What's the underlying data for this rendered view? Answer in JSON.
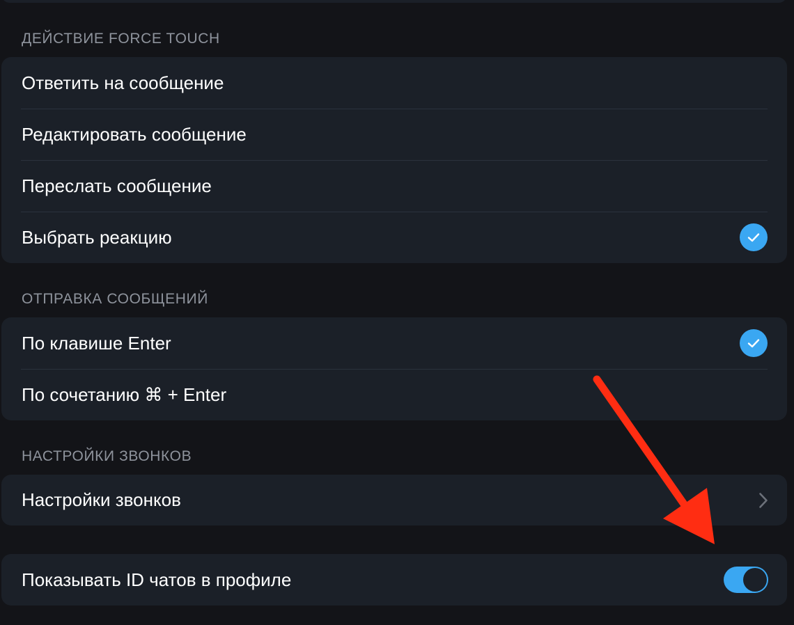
{
  "sections": {
    "force_touch": {
      "header": "ДЕЙСТВИЕ FORCE TOUCH",
      "items": [
        {
          "label": "Ответить на сообщение"
        },
        {
          "label": "Редактировать сообщение"
        },
        {
          "label": "Переслать сообщение"
        },
        {
          "label": "Выбрать реакцию",
          "selected": true
        }
      ]
    },
    "send_messages": {
      "header": "ОТПРАВКА СООБЩЕНИЙ",
      "items": [
        {
          "label": "По клавише Enter",
          "selected": true
        },
        {
          "label": "По сочетанию ⌘ + Enter"
        }
      ]
    },
    "calls": {
      "header": "НАСТРОЙКИ ЗВОНКОВ",
      "items": [
        {
          "label": "Настройки звонков",
          "icon": "chevron-right-icon"
        }
      ]
    },
    "profile": {
      "items": [
        {
          "label": "Показывать ID чатов в профиле",
          "toggle_on": true
        }
      ]
    }
  },
  "colors": {
    "background": "#131418",
    "group_background": "#1b2028",
    "accent": "#3aa7f2",
    "annotation_arrow": "#ff2d12"
  }
}
